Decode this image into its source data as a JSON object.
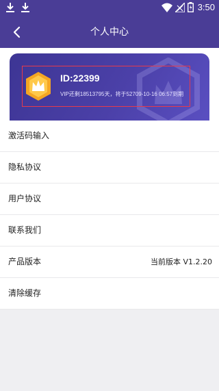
{
  "status_bar": {
    "time": "3:50",
    "icons": [
      "download-icon",
      "download-icon",
      "wifi-icon",
      "signal-icon",
      "battery-icon"
    ]
  },
  "header": {
    "title": "个人中心",
    "back_icon": "chevron-left-icon"
  },
  "vip_card": {
    "id_text": "ID:22399",
    "desc_text": "VIP还剩18513795天，将于52709-10-16 06:57到期",
    "badge_icon": "crown-icon"
  },
  "menu": {
    "items": [
      {
        "label": "激活码输入",
        "value": ""
      },
      {
        "label": "隐私协议",
        "value": ""
      },
      {
        "label": "用户协议",
        "value": ""
      },
      {
        "label": "联系我们",
        "value": ""
      },
      {
        "label": "产品版本",
        "value": "当前版本 V1.2.20"
      },
      {
        "label": "清除缓存",
        "value": ""
      }
    ]
  },
  "colors": {
    "header_bg": "#4a3d96",
    "card_start": "#3d3594",
    "card_end": "#5a4fc1",
    "badge_orange": "#f5a623",
    "highlight_red": "#e83a4a"
  }
}
